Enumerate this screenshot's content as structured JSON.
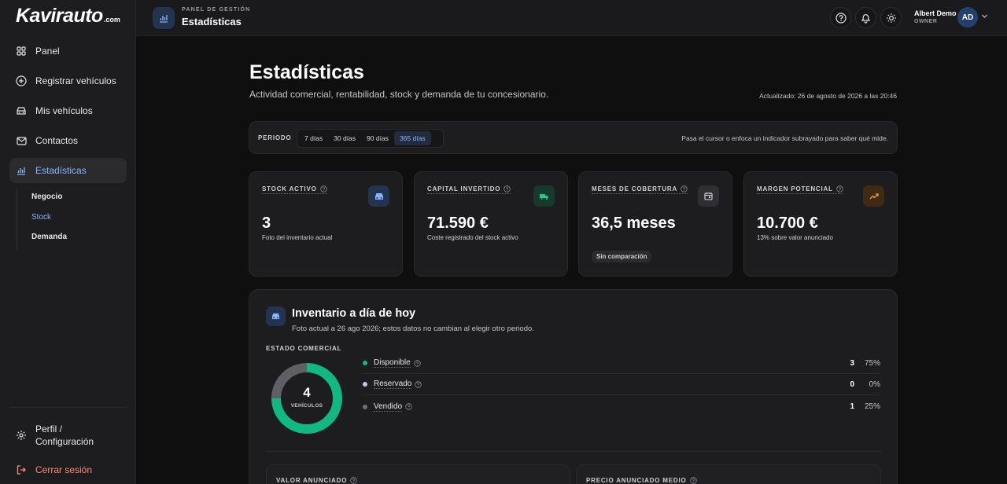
{
  "sidebar": {
    "logo_main": "Kavirauto",
    "logo_suffix": ".com",
    "items": [
      {
        "label": "Panel",
        "icon": "grid-icon"
      },
      {
        "label": "Registrar vehículos",
        "icon": "plus-circle-icon"
      },
      {
        "label": "Mis vehículos",
        "icon": "car-icon"
      },
      {
        "label": "Contactos",
        "icon": "mail-icon"
      },
      {
        "label": "Estadísticas",
        "icon": "chart-icon"
      }
    ],
    "subitems": [
      {
        "label": "Negocio"
      },
      {
        "label": "Stock"
      },
      {
        "label": "Demanda"
      }
    ],
    "profile_label_1": "Perfil /",
    "profile_label_2": "Configuración",
    "logout_label": "Cerrar sesión"
  },
  "header": {
    "kicker": "PANEL DE GESTIÓN",
    "title": "Estadísticas",
    "user_name": "Albert Demo",
    "user_role": "OWNER",
    "avatar_initials": "AD"
  },
  "main": {
    "title": "Estadísticas",
    "subtitle": "Actividad comercial, rentabilidad, stock y demanda de tu concesionario.",
    "updated": "Actualizado: 26 de agosto de 2026 a las 20:46",
    "period": {
      "label": "PERIODO",
      "options": [
        "7 días",
        "30 días",
        "90 días",
        "365 días"
      ],
      "selected": "365 días",
      "hint": "Pasa el cursor o enfoca un indicador subrayado para saber qué mide."
    },
    "kpis": [
      {
        "label": "STOCK ACTIVO",
        "value": "3",
        "note": "Foto del inventario actual",
        "icon": "car-icon",
        "color": "#8ab4ff"
      },
      {
        "label": "CAPITAL INVERTIDO",
        "value": "71.590 €",
        "note": "Coste registrado del stock activo",
        "icon": "truck-icon",
        "color": "#22c98a"
      },
      {
        "label": "MESES DE COBERTURA",
        "value": "36,5 meses",
        "chip": "Sin comparación",
        "icon": "calendar-icon",
        "color": "#c8c8ce"
      },
      {
        "label": "MARGEN POTENCIAL",
        "value": "10.700 €",
        "note": "13% sobre valor anunciado",
        "icon": "trend-up-icon",
        "color": "#f0a030"
      }
    ],
    "inventory": {
      "title": "Inventario a día de hoy",
      "subtitle": "Foto actual a 26 ago 2026; estos datos no cambian al elegir otro periodo.",
      "section": "ESTADO COMERCIAL",
      "total": "4",
      "total_caption": "VEHÍCULOS",
      "states": [
        {
          "name": "Disponible",
          "count": 3,
          "pct": "75%",
          "share": 0.75,
          "color": "#10b981"
        },
        {
          "name": "Reservado",
          "count": 0,
          "pct": "0%",
          "share": 0,
          "color": "#c7c7f0"
        },
        {
          "name": "Vendido",
          "count": 1,
          "pct": "25%",
          "share": 0.25,
          "color": "#5f5f66"
        }
      ],
      "bottom_cards": [
        {
          "label": "VALOR ANUNCIADO"
        },
        {
          "label": "PRECIO ANUNCIADO MEDIO"
        }
      ]
    }
  }
}
